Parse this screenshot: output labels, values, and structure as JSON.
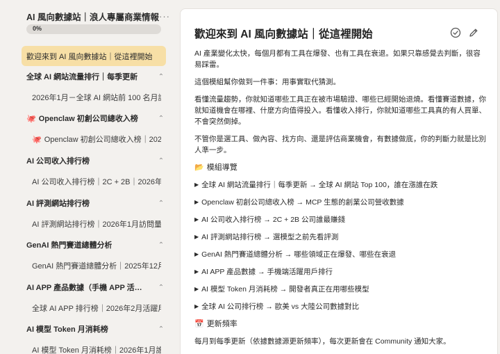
{
  "sidebar": {
    "title": "AI 風向數據站｜浪人專屬商業情報",
    "more": "···",
    "progress": {
      "value": 0,
      "label": "0%"
    },
    "active_item": "歡迎來到 AI 風向數據站｜從這裡開始",
    "groups": [
      {
        "label": "全球 AI 網站流量排行｜每季更新",
        "sub": "2026年1月－全球 AI 網站前 100 名月訪問量",
        "chevron": "⌃"
      },
      {
        "label": "Openclaw 初創公司總收入榜",
        "sub": "Openclaw 初創公司總收入榜｜2026年",
        "chevron": "⌃",
        "emoji": "🐙"
      },
      {
        "label": "AI 公司收入排行榜",
        "sub": "AI 公司收入排行榜｜2C + 2B｜2026年2月",
        "chevron": "⌃"
      },
      {
        "label": "AI 評測網站排行榜",
        "sub": "AI 評測網站排行榜｜2026年1月訪問量",
        "chevron": "⌃"
      },
      {
        "label": "GenAI 熱門賽道總體分析",
        "sub": "GenAI 熱門賽道總體分析｜2025年12月",
        "chevron": "⌃"
      },
      {
        "label": "AI APP 產品數據（手機 APP 活躍用戶）",
        "sub": "全球 AI APP 排行榜｜2026年2月活躍用戶",
        "chevron": "⌃"
      },
      {
        "label": "AI 模型 Token 月消耗榜",
        "sub": "AI 模型 Token 月消耗榜｜2026年1月誰在用",
        "chevron": "⌃"
      }
    ]
  },
  "main": {
    "title": "歡迎來到 AI 風向數據站｜從這裡開始",
    "paragraphs": [
      "AI 產業變化太快，每個月都有工具在爆發、也有工具在衰退。如果只靠感覺去判斷，很容易踩雷。",
      "這個模組幫你做到一件事：用事實取代猜測。",
      "看懂流量趨勢，你就知道哪些工具正在被市場驗證、哪些已經開始退燒。看懂賽道數據，你就知道機會在哪裡、什麼方向值得投入。看懂收入排行，你就知道哪些工具真的有人買單、不會突然倒掉。",
      "不管你是選工具、做內容、找方向、還是評估商業機會，有數據做底，你的判斷力就是比別人準一步。"
    ],
    "nav_heading": "模組導覽",
    "nav_heading_icon": "📂",
    "nav_items": [
      "全球 AI 網站流量排行｜每季更新 → 全球 AI 網站 Top 100，誰在漲誰在跌",
      "Openclaw 初創公司總收入榜 → MCP 生態的創業公司營收數據",
      "AI 公司收入排行榜 → 2C + 2B 公司誰最賺錢",
      "AI 評測網站排行榜 → 選模型之前先看評測",
      "GenAI 熱門賽道總體分析 → 哪些領域正在爆發、哪些在衰退",
      "AI APP 產品數據 → 手機端活躍用戶排行",
      "AI 模型 Token 月消耗榜 → 開發者真正在用哪些模型",
      "全球 AI 公司排行榜 → 歐美 vs 大陸公司數據對比"
    ],
    "update_heading": "更新頻率",
    "update_heading_icon": "📅",
    "update_text": "每月到每季更新（依據數據源更新頻率），每次更新會在 Community 通知大家。"
  },
  "colors": {
    "active_bg": "#f7dfa6",
    "sidebar_bg": "#f3f1ee",
    "panel_bg": "#ffffff"
  },
  "icons": {
    "more": "more-horizontal-icon",
    "check": "check-circle-icon",
    "edit": "pencil-icon",
    "chevron": "chevron-up-icon"
  }
}
